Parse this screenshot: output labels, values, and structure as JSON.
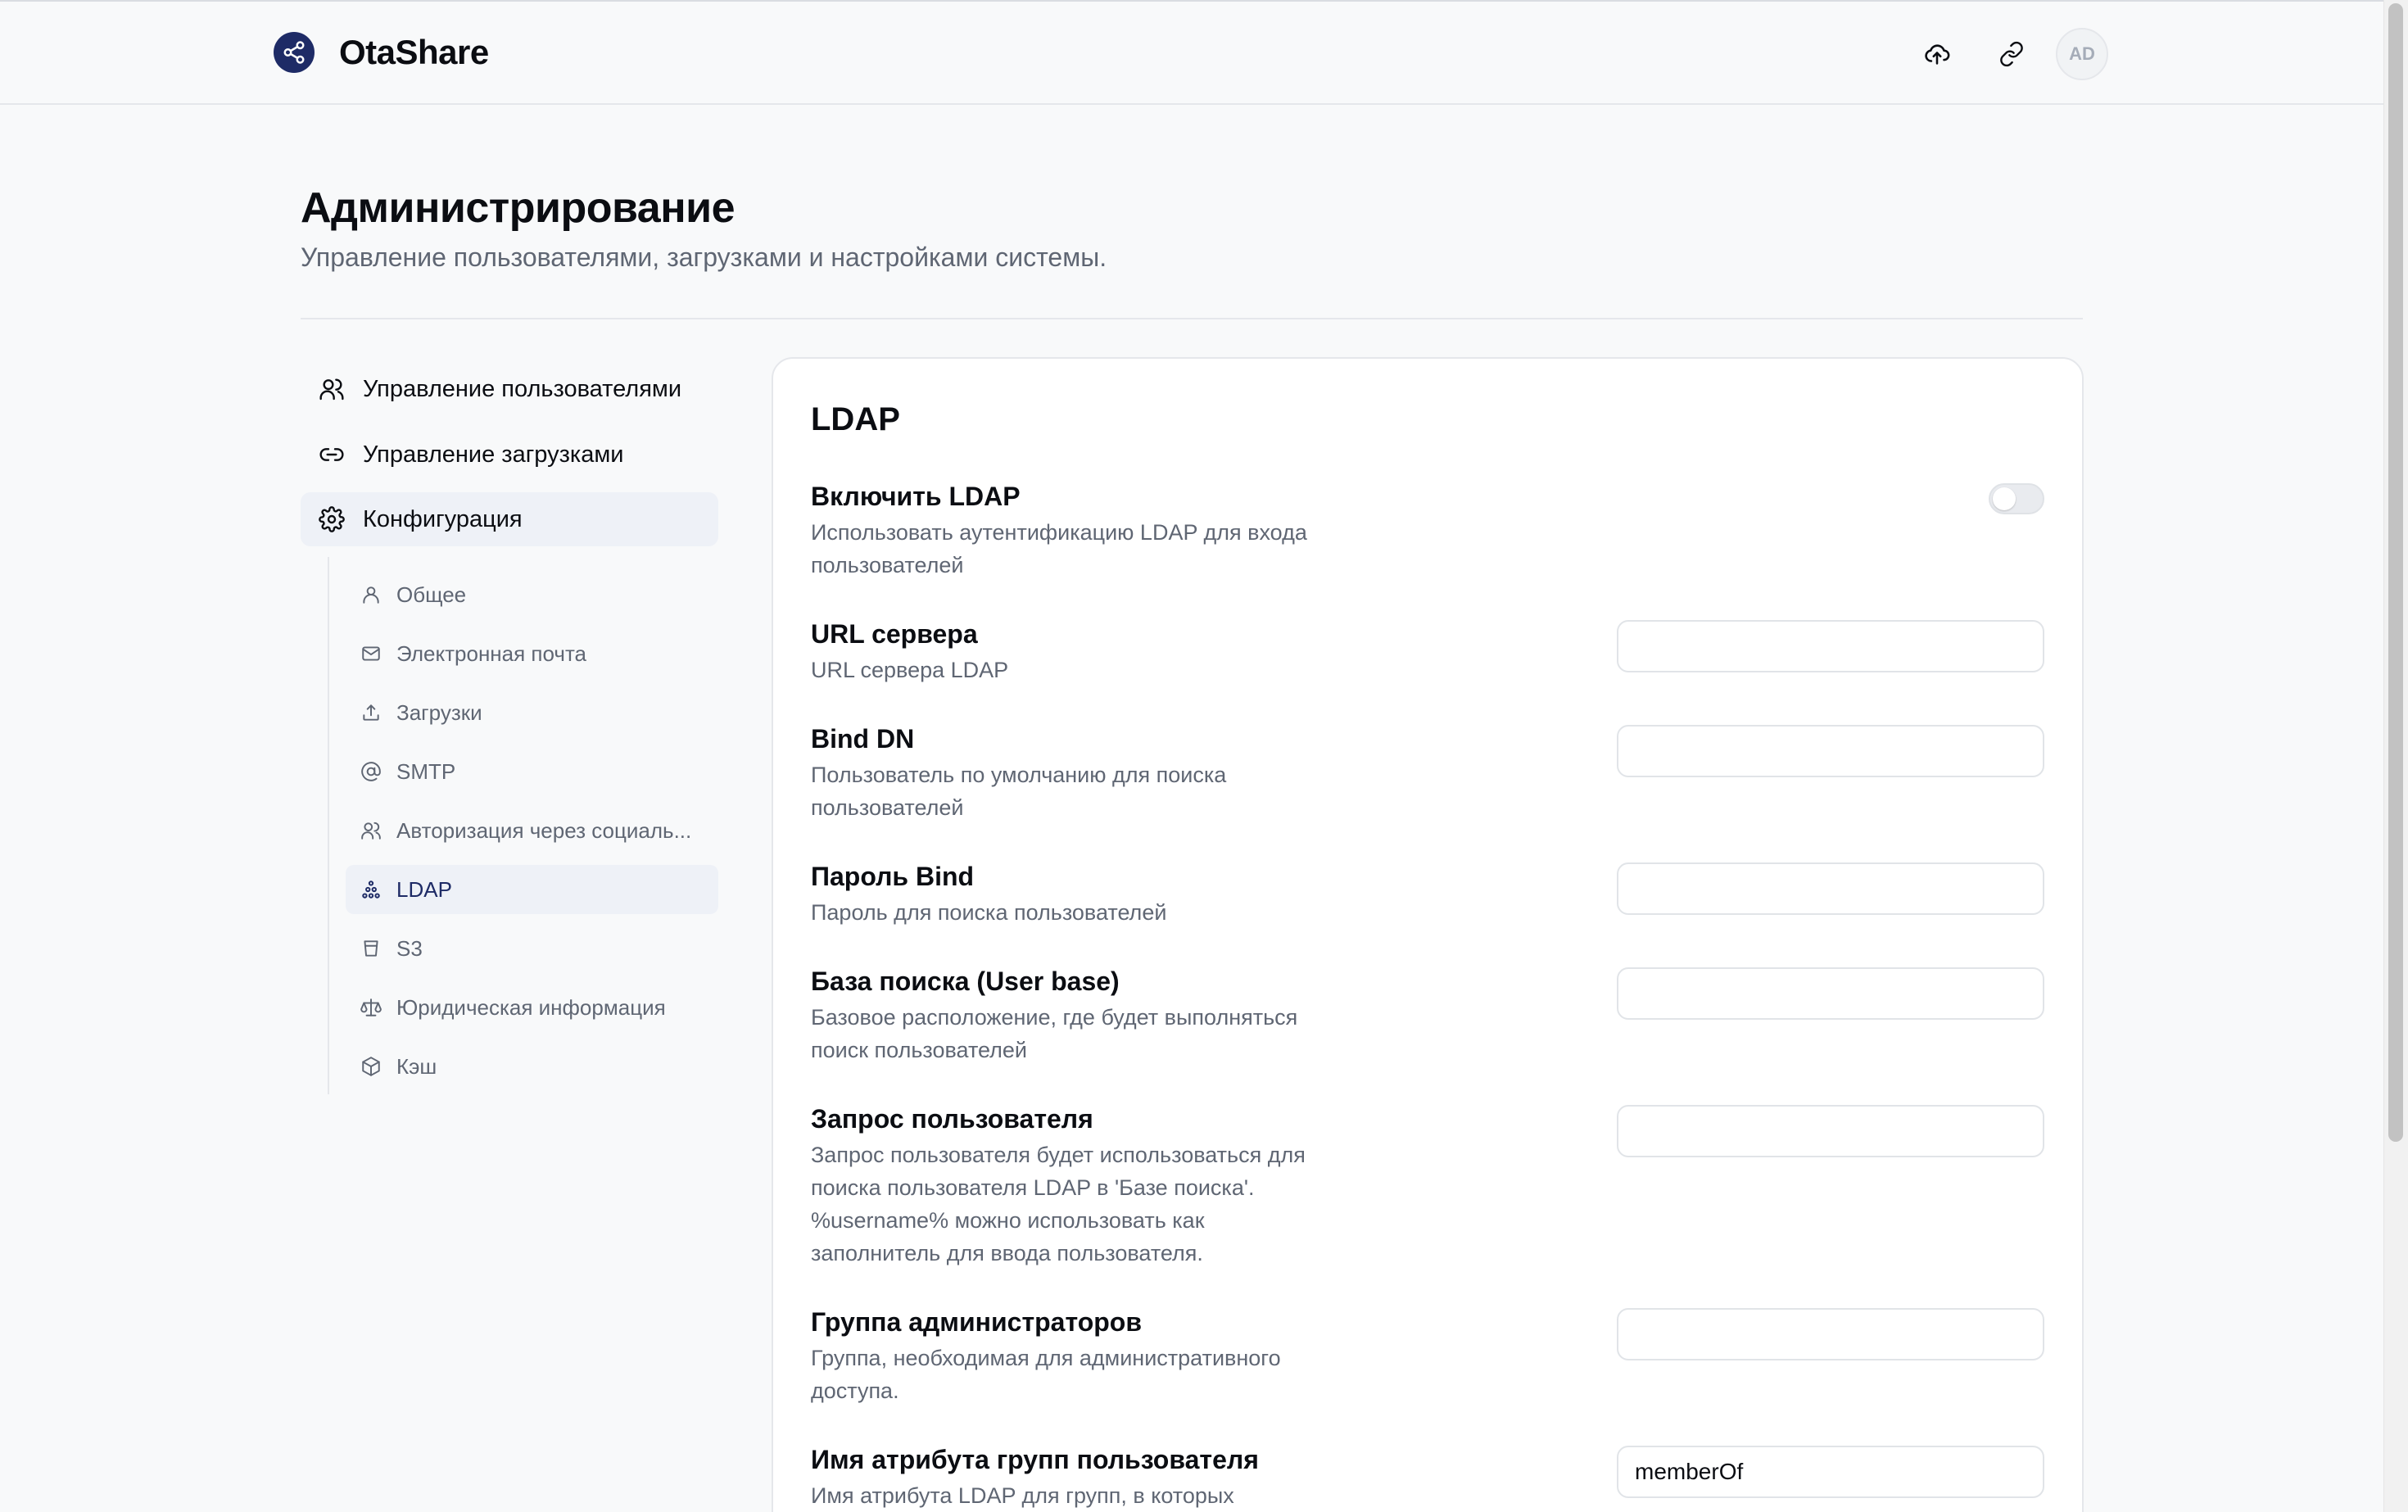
{
  "header": {
    "brand": "OtaShare",
    "avatar_initials": "AD"
  },
  "page": {
    "title": "Администрирование",
    "subtitle": "Управление пользователями, загрузками и настройками системы."
  },
  "nav": {
    "items": [
      {
        "label": "Управление пользователями",
        "icon": "users-icon"
      },
      {
        "label": "Управление загрузками",
        "icon": "link-icon"
      },
      {
        "label": "Конфигурация",
        "icon": "gear-icon"
      }
    ],
    "config_items": [
      {
        "label": "Общее",
        "icon": "user-icon"
      },
      {
        "label": "Электронная почта",
        "icon": "mail-icon"
      },
      {
        "label": "Загрузки",
        "icon": "upload-icon"
      },
      {
        "label": "SMTP",
        "icon": "at-icon"
      },
      {
        "label": "Авторизация через социаль...",
        "icon": "users-icon"
      },
      {
        "label": "LDAP",
        "icon": "network-icon"
      },
      {
        "label": "S3",
        "icon": "bucket-icon"
      },
      {
        "label": "Юридическая информация",
        "icon": "scale-icon"
      },
      {
        "label": "Кэш",
        "icon": "box-icon"
      }
    ]
  },
  "ldap": {
    "title": "LDAP",
    "enable": {
      "label": "Включить LDAP",
      "desc": "Использовать аутентификацию LDAP для входа пользователей",
      "enabled": false
    },
    "fields": [
      {
        "label": "URL сервера",
        "desc": "URL сервера LDAP",
        "value": ""
      },
      {
        "label": "Bind DN",
        "desc": "Пользователь по умолчанию для поиска пользователей",
        "value": ""
      },
      {
        "label": "Пароль Bind",
        "desc": "Пароль для поиска пользователей",
        "value": ""
      },
      {
        "label": "База поиска (User base)",
        "desc": "Базовое расположение, где будет выполняться поиск пользователей",
        "value": ""
      },
      {
        "label": "Запрос пользователя",
        "desc": "Запрос пользователя будет использоваться для поиска пользователя LDAP в 'Базе поиска'. %username% можно использовать как заполнитель для ввода пользователя.",
        "value": ""
      },
      {
        "label": "Группа администраторов",
        "desc": "Группа, необходимая для административного доступа.",
        "value": ""
      },
      {
        "label": "Имя атрибута групп пользователя",
        "desc": "Имя атрибута LDAP для групп, в которых",
        "value": "memberOf"
      }
    ]
  }
}
